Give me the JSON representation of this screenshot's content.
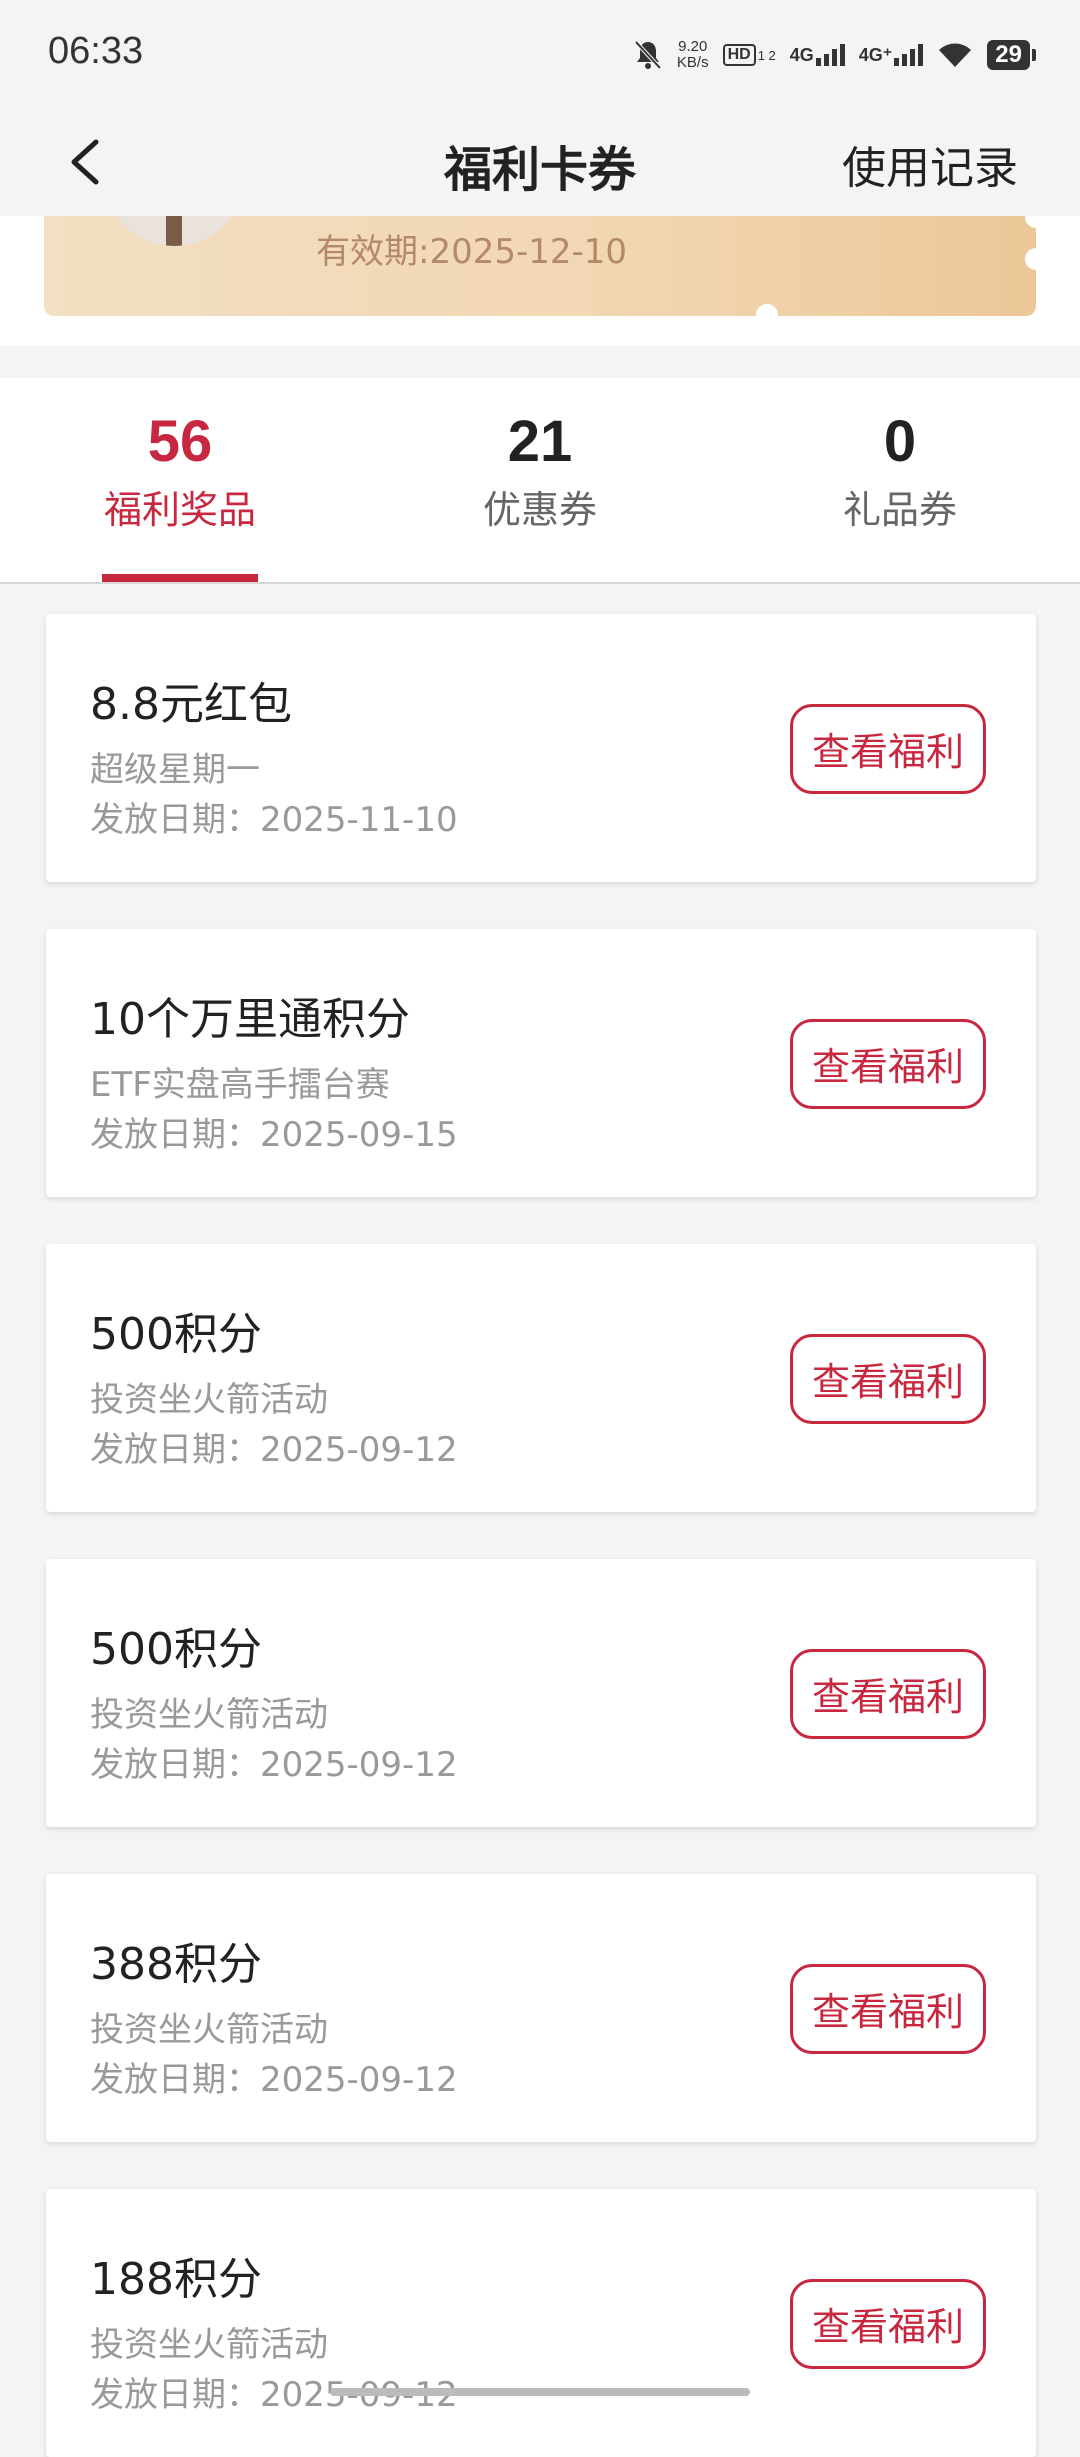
{
  "status_bar": {
    "time": "06:33",
    "speed_value": "9.20",
    "speed_unit": "KB/s",
    "hd_label": "HD",
    "hd_sub": "1 2",
    "sig1_label": "4G",
    "sig2_label": "4G⁺",
    "battery": "29"
  },
  "nav": {
    "title": "福利卡券",
    "history_label": "使用记录"
  },
  "voucher": {
    "validity": "有效期:2025-12-10"
  },
  "tabs": [
    {
      "count": "56",
      "label": "福利奖品"
    },
    {
      "count": "21",
      "label": "优惠券"
    },
    {
      "count": "0",
      "label": "礼品券"
    }
  ],
  "items": [
    {
      "title": "8.8元红包",
      "source": "超级星期一",
      "date": "发放日期：2025-11-10",
      "button": "查看福利"
    },
    {
      "title": "10个万里通积分",
      "source": "ETF实盘高手擂台赛",
      "date": "发放日期：2025-09-15",
      "button": "查看福利"
    },
    {
      "title": "500积分",
      "source": "投资坐火箭活动",
      "date": "发放日期：2025-09-12",
      "button": "查看福利"
    },
    {
      "title": "500积分",
      "source": "投资坐火箭活动",
      "date": "发放日期：2025-09-12",
      "button": "查看福利"
    },
    {
      "title": "388积分",
      "source": "投资坐火箭活动",
      "date": "发放日期：2025-09-12",
      "button": "查看福利"
    },
    {
      "title": "188积分",
      "source": "投资坐火箭活动",
      "date": "发放日期：2025-09-12",
      "button": "查看福利"
    }
  ],
  "colors": {
    "accent": "#c8283f",
    "background": "#f4f4f4",
    "voucher_gold": "#f1d6b1"
  }
}
